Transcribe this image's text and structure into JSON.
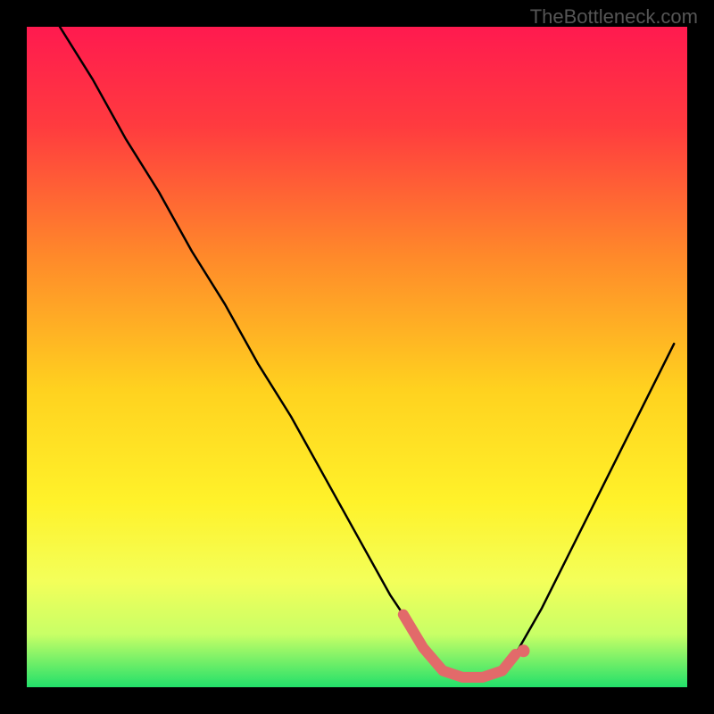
{
  "watermark": "TheBottleneck.com",
  "chart_data": {
    "type": "line",
    "title": "",
    "xlabel": "",
    "ylabel": "",
    "xlim": [
      0,
      100
    ],
    "ylim": [
      0,
      100
    ],
    "description": "Bottleneck V-curve over a vertical red-yellow-green gradient. The black curve drops from near 100% at the left edge down to ~0% around x≈62–72 (highlighted with a pink segment along the minimum) then rises again toward the right edge.",
    "series": [
      {
        "name": "bottleneck-curve",
        "x": [
          5,
          10,
          15,
          20,
          25,
          30,
          35,
          40,
          45,
          50,
          55,
          57,
          60,
          63,
          66,
          69,
          72,
          74,
          78,
          82,
          86,
          90,
          94,
          98
        ],
        "values": [
          100,
          92,
          83,
          75,
          66,
          58,
          49,
          41,
          32,
          23,
          14,
          11,
          6,
          2.5,
          1.5,
          1.5,
          2.5,
          5,
          12,
          20,
          28,
          36,
          44,
          52
        ]
      }
    ],
    "highlight": {
      "name": "optimal-zone",
      "x": [
        57,
        60,
        63,
        66,
        69,
        72,
        74
      ],
      "values": [
        11,
        6,
        2.5,
        1.5,
        1.5,
        2.5,
        5
      ],
      "color": "#e26a6a"
    },
    "gradient_stops": [
      {
        "offset": 0.0,
        "color": "#ff1a4f"
      },
      {
        "offset": 0.15,
        "color": "#ff3b3f"
      },
      {
        "offset": 0.35,
        "color": "#ff8a2a"
      },
      {
        "offset": 0.55,
        "color": "#ffd21f"
      },
      {
        "offset": 0.72,
        "color": "#fff22a"
      },
      {
        "offset": 0.84,
        "color": "#f3ff5a"
      },
      {
        "offset": 0.92,
        "color": "#c8ff66"
      },
      {
        "offset": 1.0,
        "color": "#22e06a"
      }
    ]
  }
}
